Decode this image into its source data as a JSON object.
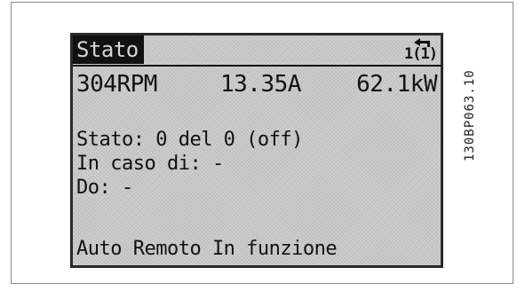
{
  "display": {
    "title": "Stato",
    "menu_indicator": "1(1)",
    "readouts": {
      "speed": "304RPM",
      "current": "13.35A",
      "power": "62.1kW"
    },
    "status_lines": [
      "Stato: 0 del 0 (off)",
      "In caso di: -",
      "Do: -"
    ],
    "mode_line": "Auto Remoto In funzione"
  },
  "figure_code": "130BP063.10",
  "colors": {
    "lcd_background": "#cfcfcf",
    "lcd_text": "#111111",
    "title_highlight": "#111111"
  }
}
